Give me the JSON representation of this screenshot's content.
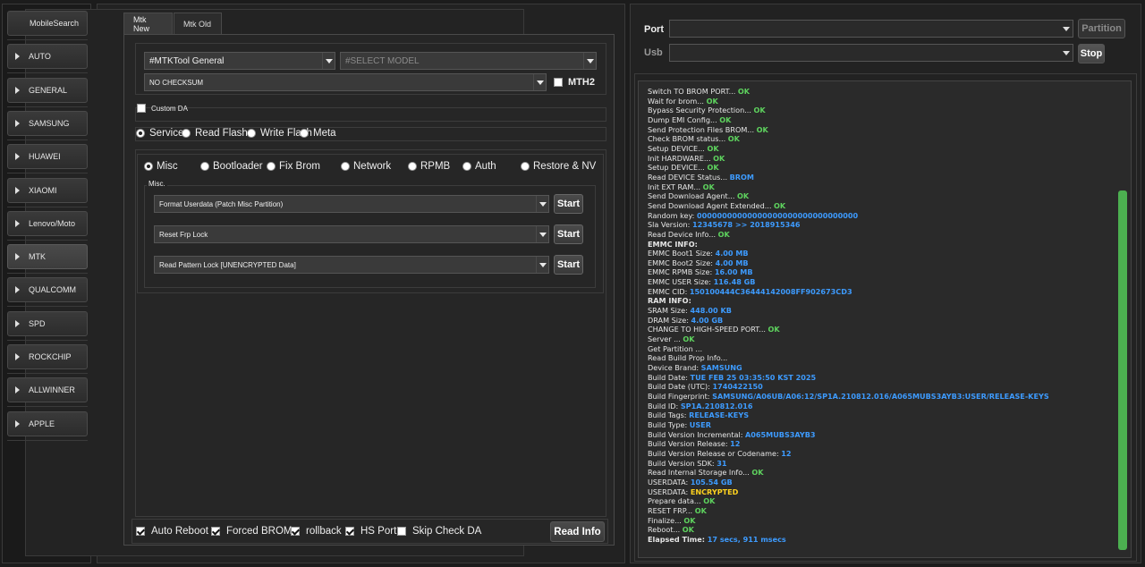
{
  "sidebar": {
    "items": [
      {
        "label": "MobileSearch",
        "active": false
      },
      {
        "label": "AUTO",
        "active": false
      },
      {
        "label": "GENERAL",
        "active": false
      },
      {
        "label": "SAMSUNG",
        "active": false
      },
      {
        "label": "HUAWEI",
        "active": false
      },
      {
        "label": "XIAOMI",
        "active": false
      },
      {
        "label": "Lenovo/Moto",
        "active": false
      },
      {
        "label": "MTK",
        "active": true
      },
      {
        "label": "QUALCOMM",
        "active": false
      },
      {
        "label": "SPD",
        "active": false
      },
      {
        "label": "ROCKCHIP",
        "active": false
      },
      {
        "label": "ALLWINNER",
        "active": false
      },
      {
        "label": "APPLE",
        "active": false
      }
    ]
  },
  "tabs": [
    {
      "label": "Mtk New",
      "active": true
    },
    {
      "label": "Mtk Old",
      "active": false
    }
  ],
  "mtk": {
    "tool_select": "#MTKTool General",
    "model_select": "#SELECT MODEL",
    "checksum_select": "NO CHECKSUM",
    "mth2_label": "MTH2",
    "mth2_checked": false,
    "custom_da_label": "Custom DA",
    "custom_da_checked": false,
    "modes": [
      {
        "label": "Service",
        "selected": true
      },
      {
        "label": "Read Flash",
        "selected": false
      },
      {
        "label": "Write Flash",
        "selected": false
      },
      {
        "label": "Meta",
        "selected": false
      }
    ],
    "categories": [
      {
        "label": "Misc",
        "selected": true
      },
      {
        "label": "Bootloader",
        "selected": false
      },
      {
        "label": "Fix Brom",
        "selected": false
      },
      {
        "label": "Network",
        "selected": false
      },
      {
        "label": "RPMB",
        "selected": false
      },
      {
        "label": "Auth",
        "selected": false
      },
      {
        "label": "Restore & NV",
        "selected": false
      }
    ],
    "misc_group_label": "Misc.",
    "operations": [
      {
        "select": "Format Userdata (Patch Misc Partition)",
        "button": "Start"
      },
      {
        "select": "Reset Frp Lock",
        "button": "Start"
      },
      {
        "select": "Read Pattern Lock [UNENCRYPTED Data]",
        "button": "Start"
      }
    ]
  },
  "bottom_options": [
    {
      "label": "Auto Reboot",
      "checked": true
    },
    {
      "label": "Forced BROM",
      "checked": true
    },
    {
      "label": "rollback",
      "checked": true
    },
    {
      "label": "HS Port",
      "checked": true
    },
    {
      "label": "Skip Check DA",
      "checked": false
    }
  ],
  "read_info_button": "Read Info",
  "connection": {
    "port_label": "Port",
    "usb_label": "Usb",
    "port_value": "",
    "usb_value": "",
    "partition_button": "Partition",
    "stop_button": "Stop"
  },
  "colors": {
    "ok": "#5ed35e",
    "info": "#3d9bff",
    "warn": "#ffd21f",
    "scrollbar": "#4caf50"
  },
  "log": [
    [
      {
        "t": "Switch TO BROM PORT... "
      },
      {
        "t": "OK",
        "c": "ok"
      }
    ],
    [
      {
        "t": "Wait for brom... "
      },
      {
        "t": "OK",
        "c": "ok"
      }
    ],
    [
      {
        "t": "Bypass Security Protection... "
      },
      {
        "t": "OK",
        "c": "ok"
      }
    ],
    [
      {
        "t": "Dump EMI Config... "
      },
      {
        "t": "OK",
        "c": "ok"
      }
    ],
    [
      {
        "t": "Send Protection Files BROM... "
      },
      {
        "t": "OK",
        "c": "ok"
      }
    ],
    [
      {
        "t": "Check BROM status... "
      },
      {
        "t": "OK",
        "c": "ok"
      }
    ],
    [
      {
        "t": "Setup DEVICE... "
      },
      {
        "t": "OK",
        "c": "ok"
      }
    ],
    [
      {
        "t": "Init HARDWARE... "
      },
      {
        "t": "OK",
        "c": "ok"
      }
    ],
    [
      {
        "t": "Setup DEVICE... "
      },
      {
        "t": "OK",
        "c": "ok"
      }
    ],
    [
      {
        "t": "Read DEVICE Status... "
      },
      {
        "t": "BROM",
        "c": "info"
      }
    ],
    [
      {
        "t": "Init EXT RAM... "
      },
      {
        "t": "OK",
        "c": "ok"
      }
    ],
    [
      {
        "t": "Send Download Agent... "
      },
      {
        "t": "OK",
        "c": "ok"
      }
    ],
    [
      {
        "t": "Send Download Agent Extended... "
      },
      {
        "t": "OK",
        "c": "ok"
      }
    ],
    [
      {
        "t": "Random key:  "
      },
      {
        "t": "00000000000000000000000000000000",
        "c": "info"
      }
    ],
    [
      {
        "t": "Sla Version:  "
      },
      {
        "t": "12345678  >> 2018915346",
        "c": "info"
      }
    ],
    [
      {
        "t": "Read Device Info... "
      },
      {
        "t": "OK",
        "c": "ok"
      }
    ],
    [
      {
        "t": "EMMC INFO:",
        "c": "bold"
      }
    ],
    [
      {
        "t": "EMMC Boot1 Size: "
      },
      {
        "t": "4.00 MB",
        "c": "info"
      }
    ],
    [
      {
        "t": "EMMC Boot2 Size: "
      },
      {
        "t": "4.00 MB",
        "c": "info"
      }
    ],
    [
      {
        "t": "EMMC RPMB Size: "
      },
      {
        "t": "16.00 MB",
        "c": "info"
      }
    ],
    [
      {
        "t": "EMMC USER Size: "
      },
      {
        "t": "116.48 GB",
        "c": "info"
      }
    ],
    [
      {
        "t": "EMMC CID: "
      },
      {
        "t": "150100444C36444142008FF902673CD3",
        "c": "info"
      }
    ],
    [
      {
        "t": "RAM INFO:",
        "c": "bold"
      }
    ],
    [
      {
        "t": "SRAM Size: "
      },
      {
        "t": "448.00 KB",
        "c": "info"
      }
    ],
    [
      {
        "t": "DRAM Size: "
      },
      {
        "t": "4.00 GB",
        "c": "info"
      }
    ],
    [
      {
        "t": "CHANGE TO HIGH-SPEED PORT... "
      },
      {
        "t": "OK",
        "c": "ok"
      }
    ],
    [
      {
        "t": "Server ... "
      },
      {
        "t": "OK",
        "c": "ok"
      }
    ],
    [
      {
        "t": "Get Partition ..."
      }
    ],
    [
      {
        "t": "Read Build Prop Info..."
      }
    ],
    [
      {
        "t": " Device Brand: "
      },
      {
        "t": "SAMSUNG",
        "c": "info"
      }
    ],
    [
      {
        "t": " Build Date: "
      },
      {
        "t": "TUE FEB 25 03:35:50 KST 2025",
        "c": "info"
      }
    ],
    [
      {
        "t": " Build Date (UTC): "
      },
      {
        "t": "1740422150",
        "c": "info"
      }
    ],
    [
      {
        "t": " Build Fingerprint: "
      },
      {
        "t": "SAMSUNG/A06UB/A06:12/SP1A.210812.016/A065MUBS3AYB3:USER/RELEASE-KEYS",
        "c": "info"
      }
    ],
    [
      {
        "t": " Build ID: "
      },
      {
        "t": "SP1A.210812.016",
        "c": "info"
      }
    ],
    [
      {
        "t": " Build Tags: "
      },
      {
        "t": "RELEASE-KEYS",
        "c": "info"
      }
    ],
    [
      {
        "t": " Build Type: "
      },
      {
        "t": "USER",
        "c": "info"
      }
    ],
    [
      {
        "t": " Build Version Incremental: "
      },
      {
        "t": "A065MUBS3AYB3",
        "c": "info"
      }
    ],
    [
      {
        "t": " Build Version Release: "
      },
      {
        "t": "12",
        "c": "info"
      }
    ],
    [
      {
        "t": " Build Version Release or Codename: "
      },
      {
        "t": "12",
        "c": "info"
      }
    ],
    [
      {
        "t": " Build Version SDK: "
      },
      {
        "t": "31",
        "c": "info"
      }
    ],
    [
      {
        "t": "Read Internal Storage Info... "
      },
      {
        "t": "OK",
        "c": "ok"
      }
    ],
    [
      {
        "t": "USERDATA: "
      },
      {
        "t": "105.54 GB",
        "c": "info"
      }
    ],
    [
      {
        "t": "USERDATA: "
      },
      {
        "t": "ENCRYPTED",
        "c": "warn"
      }
    ],
    [
      {
        "t": "Prepare data... "
      },
      {
        "t": "OK",
        "c": "ok"
      }
    ],
    [
      {
        "t": "RESET FRP... "
      },
      {
        "t": "OK",
        "c": "ok"
      }
    ],
    [
      {
        "t": "Finalize... "
      },
      {
        "t": "OK",
        "c": "ok"
      }
    ],
    [
      {
        "t": "Reboot... "
      },
      {
        "t": "OK",
        "c": "ok"
      }
    ],
    [
      {
        "t": "Elapsed Time: ",
        "c": "bold"
      },
      {
        "t": "17 secs, 911 msecs",
        "c": "info"
      }
    ]
  ]
}
